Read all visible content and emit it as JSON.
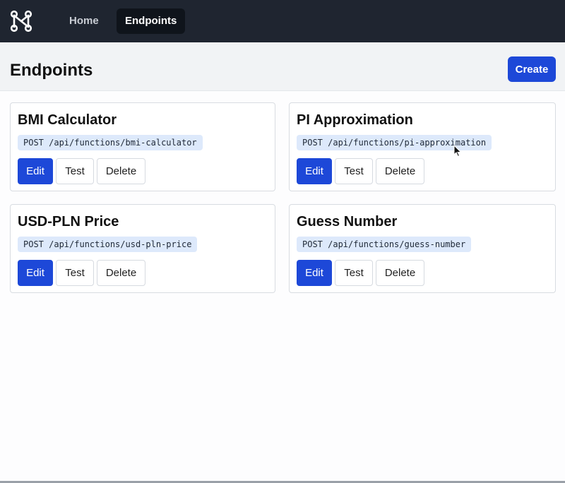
{
  "navbar": {
    "logo_icon": "node-graph-logo-icon",
    "links": [
      {
        "label": "Home",
        "active": false
      },
      {
        "label": "Endpoints",
        "active": true
      }
    ]
  },
  "header": {
    "title": "Endpoints",
    "create_label": "Create"
  },
  "cards": [
    {
      "title": "BMI Calculator",
      "endpoint": "POST /api/functions/bmi-calculator"
    },
    {
      "title": "PI Approximation",
      "endpoint": "POST /api/functions/pi-approximation"
    },
    {
      "title": "USD-PLN Price",
      "endpoint": "POST /api/functions/usd-pln-price"
    },
    {
      "title": "Guess Number",
      "endpoint": "POST /api/functions/guess-number"
    }
  ],
  "card_actions": {
    "edit_label": "Edit",
    "test_label": "Test",
    "delete_label": "Delete"
  },
  "colors": {
    "navbar_bg": "#1f2530",
    "primary": "#1d48d8",
    "endpoint_badge_bg": "#dde9fb"
  }
}
